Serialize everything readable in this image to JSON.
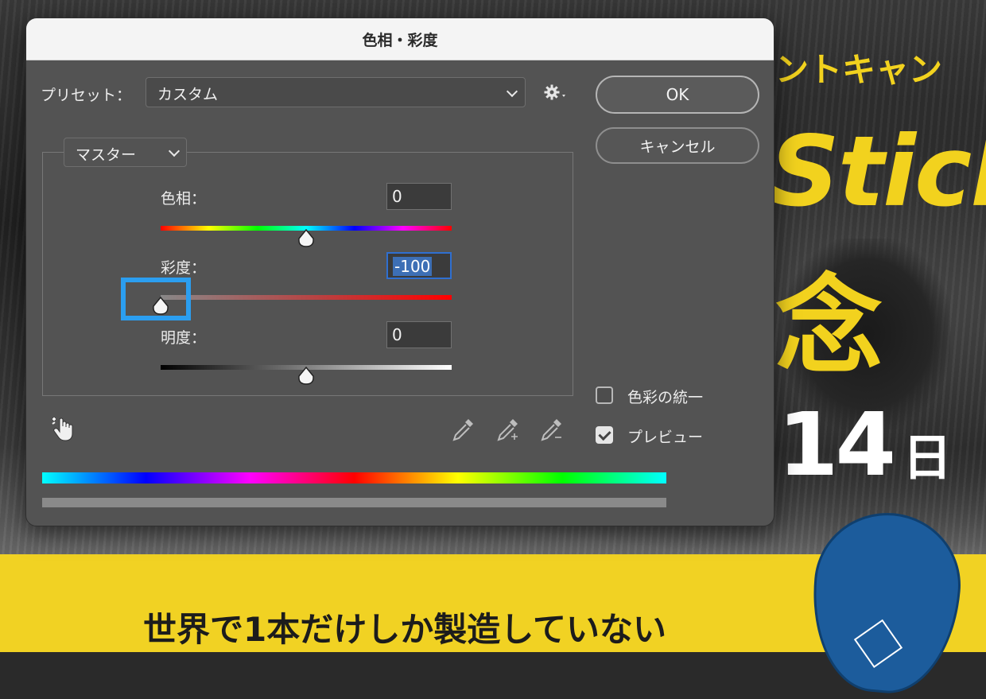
{
  "dialog": {
    "title": "色相・彩度",
    "preset_label": "プリセット：",
    "preset_value": "カスタム",
    "gear_icon": "gear-icon",
    "ok_label": "OK",
    "cancel_label": "キャンセル",
    "channel_value": "マスター",
    "hue": {
      "label": "色相：",
      "value": "0",
      "slider_min": -180,
      "slider_max": 180
    },
    "saturation": {
      "label": "彩度：",
      "value": "-100",
      "slider_min": -100,
      "slider_max": 100
    },
    "lightness": {
      "label": "明度：",
      "value": "0",
      "slider_min": -100,
      "slider_max": 100
    },
    "colorize": {
      "label": "色彩の統一",
      "checked": false
    },
    "preview": {
      "label": "プレビュー",
      "checked": true
    },
    "highlight_color": "#2b9ef0",
    "icons": [
      "targeted-adjustment-hand-icon",
      "eyedropper-icon",
      "eyedropper-plus-icon",
      "eyedropper-minus-icon"
    ]
  },
  "background": {
    "campaign_text": "ントキャン",
    "stick_text": "Stick",
    "nen_text": "念",
    "date_number": "14",
    "date_unit": "日",
    "tagline": "世界で1本だけしか製造していない",
    "accent_yellow": "#f1d223",
    "board_blue": "#1c5c9c"
  }
}
